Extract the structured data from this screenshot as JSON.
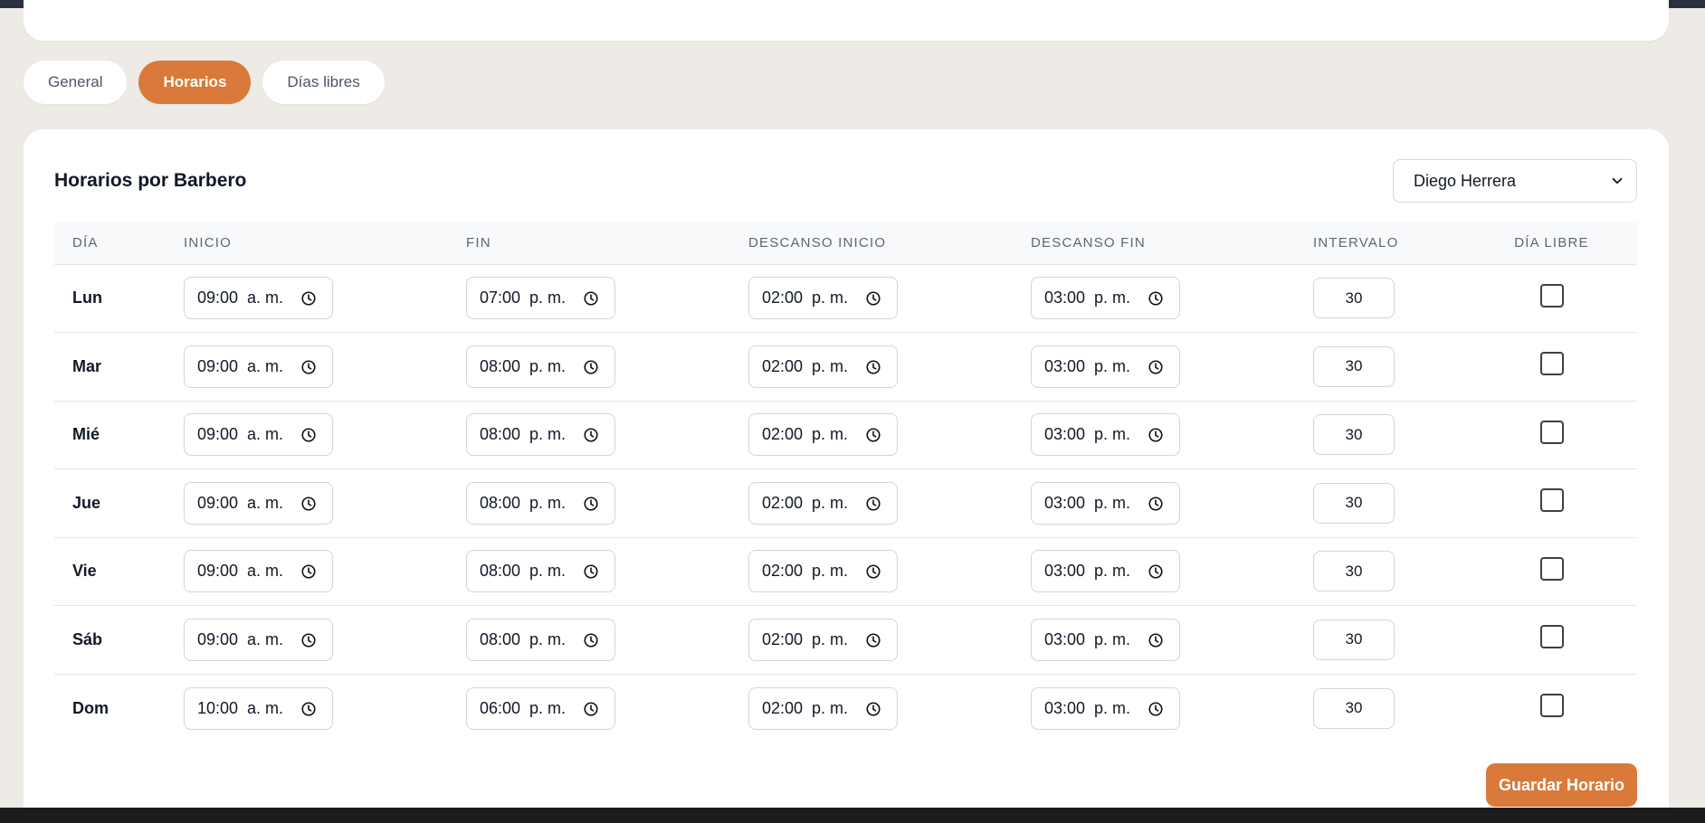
{
  "tabs": [
    {
      "label": "General",
      "active": false
    },
    {
      "label": "Horarios",
      "active": true
    },
    {
      "label": "Días libres",
      "active": false
    }
  ],
  "schedule": {
    "title": "Horarios por Barbero",
    "barber_selected": "Diego Herrera",
    "columns": [
      "DÍA",
      "INICIO",
      "FIN",
      "DESCANSO INICIO",
      "DESCANSO FIN",
      "INTERVALO",
      "DÍA LIBRE"
    ],
    "rows": [
      {
        "day": "Lun",
        "start": "09:00  a. m.",
        "end": "07:00  p. m.",
        "break_start": "02:00  p. m.",
        "break_end": "03:00  p. m.",
        "interval": "30",
        "day_off": false
      },
      {
        "day": "Mar",
        "start": "09:00  a. m.",
        "end": "08:00  p. m.",
        "break_start": "02:00  p. m.",
        "break_end": "03:00  p. m.",
        "interval": "30",
        "day_off": false
      },
      {
        "day": "Mié",
        "start": "09:00  a. m.",
        "end": "08:00  p. m.",
        "break_start": "02:00  p. m.",
        "break_end": "03:00  p. m.",
        "interval": "30",
        "day_off": false
      },
      {
        "day": "Jue",
        "start": "09:00  a. m.",
        "end": "08:00  p. m.",
        "break_start": "02:00  p. m.",
        "break_end": "03:00  p. m.",
        "interval": "30",
        "day_off": false
      },
      {
        "day": "Vie",
        "start": "09:00  a. m.",
        "end": "08:00  p. m.",
        "break_start": "02:00  p. m.",
        "break_end": "03:00  p. m.",
        "interval": "30",
        "day_off": false
      },
      {
        "day": "Sáb",
        "start": "09:00  a. m.",
        "end": "08:00  p. m.",
        "break_start": "02:00  p. m.",
        "break_end": "03:00  p. m.",
        "interval": "30",
        "day_off": false
      },
      {
        "day": "Dom",
        "start": "10:00  a. m.",
        "end": "06:00  p. m.",
        "break_start": "02:00  p. m.",
        "break_end": "03:00  p. m.",
        "interval": "30",
        "day_off": false
      }
    ],
    "save_label": "Guardar Horario"
  },
  "colors": {
    "accent": "#d97a3b",
    "background": "#eeebe6",
    "card": "#ffffff"
  },
  "icons": {
    "time_input": "clock-icon",
    "select": "chevron-down-icon"
  }
}
